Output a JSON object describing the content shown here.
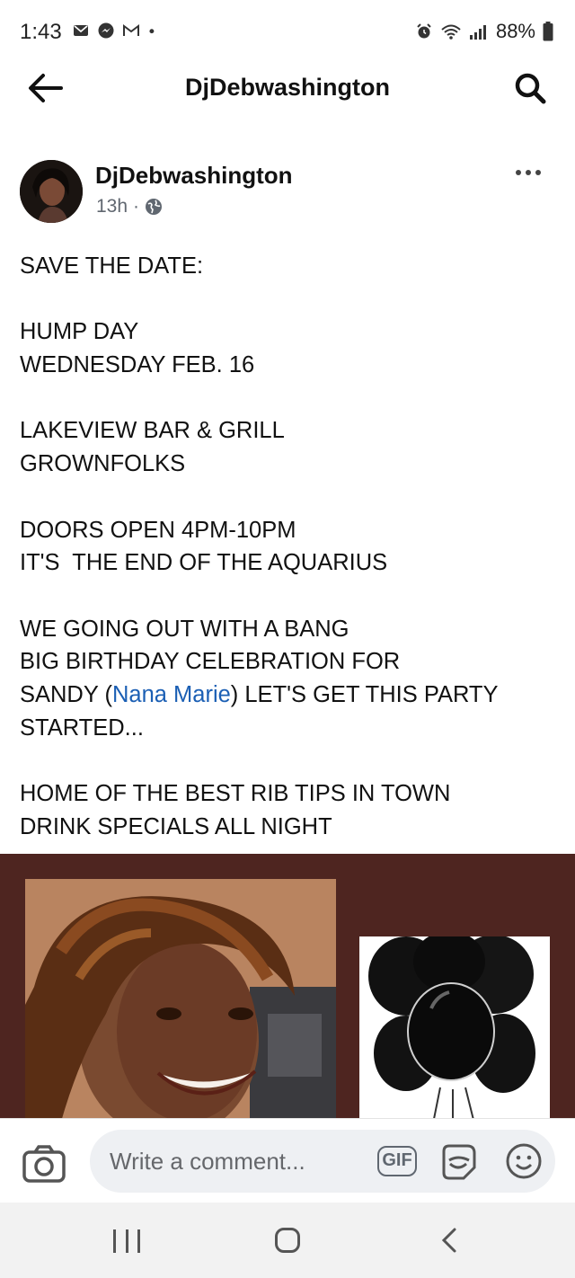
{
  "status_bar": {
    "time": "1:43",
    "notification_icons": [
      "gmail-icon",
      "messenger-icon",
      "gmail-m-icon",
      "dot-icon"
    ],
    "status_icons": [
      "alarm-icon",
      "wifi-icon",
      "signal-icon",
      "battery-icon"
    ],
    "battery": "88%"
  },
  "app_bar": {
    "title": "DjDebwashington",
    "back_icon": "arrow-left-icon",
    "search_icon": "search-icon"
  },
  "post": {
    "author": "DjDebwashington",
    "time": "13h",
    "separator": "·",
    "privacy_icon": "globe-icon",
    "paragraphs": [
      [
        "SAVE THE DATE:"
      ],
      [
        "HUMP DAY",
        "WEDNESDAY FEB. 16"
      ],
      [
        "LAKEVIEW BAR & GRILL",
        "GROWNFOLKS"
      ],
      [
        "DOORS OPEN 4PM-10PM",
        "IT'S  THE END OF THE AQUARIUS"
      ],
      [
        "WE GOING OUT WITH A BANG",
        "BIG BIRTHDAY CELEBRATION FOR"
      ],
      [
        "HOME OF THE BEST RIB TIPS IN TOWN",
        "DRINK SPECIALS ALL NIGHT"
      ]
    ],
    "sandy_line": {
      "before": "SANDY (",
      "mention": "Nana Marie",
      "after": ") LET'S GET THIS PARTY"
    },
    "started_line": "STARTED...",
    "image_colors": {
      "background": "#4e2520"
    }
  },
  "comment_bar": {
    "placeholder": "Write a comment...",
    "gif_label": "GIF",
    "camera_icon": "camera-icon",
    "sticker_icon": "sticker-icon",
    "emoji_icon": "emoji-icon"
  },
  "nav_bar": {
    "recents_icon": "recents-icon",
    "home_icon": "home-icon",
    "back_icon": "back-chevron-icon"
  }
}
